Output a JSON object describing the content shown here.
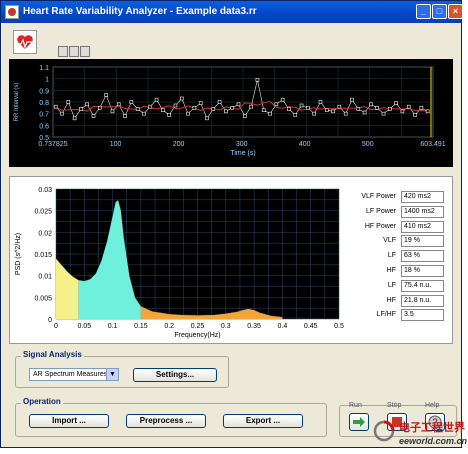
{
  "window": {
    "title": "Heart Rate Variability Analyzer - Example data3.rr"
  },
  "title_buttons": {
    "minimize": "_",
    "maximize": "□",
    "close": "×"
  },
  "top_chart": {
    "x_label": "Time (s)",
    "y_label": "RR Interval (s)",
    "x_ticks": [
      "0.737825",
      "100",
      "200",
      "300",
      "400",
      "500",
      "603.491"
    ],
    "y_ticks": [
      "1.1",
      "1",
      "0.9",
      "0.8",
      "0.7",
      "0.6",
      "0.5"
    ]
  },
  "chart_data": [
    {
      "type": "scatter",
      "y_label": "RR Interval (s)",
      "xlabel": "Time (s)",
      "xlim": [
        0.737825,
        603.491
      ],
      "ylim": [
        0.5,
        1.1
      ],
      "series": [
        {
          "x": [
            5,
            15,
            25,
            35,
            45,
            55,
            65,
            75,
            85,
            95,
            105,
            115,
            125,
            135,
            145,
            155,
            165,
            175,
            185,
            195,
            205,
            215,
            225,
            235,
            245,
            255,
            265,
            275,
            285,
            295,
            305,
            315,
            325,
            335,
            345,
            355,
            365,
            375,
            385,
            395,
            405,
            415,
            425,
            435,
            445,
            455,
            465,
            475,
            485,
            495,
            505,
            515,
            525,
            535,
            545,
            555,
            565,
            575,
            585,
            595
          ],
          "y": [
            0.76,
            0.7,
            0.8,
            0.66,
            0.74,
            0.78,
            0.68,
            0.75,
            0.86,
            0.72,
            0.78,
            0.68,
            0.8,
            0.74,
            0.7,
            0.76,
            0.82,
            0.73,
            0.69,
            0.77,
            0.83,
            0.7,
            0.75,
            0.79,
            0.66,
            0.74,
            0.8,
            0.72,
            0.75,
            0.78,
            0.68,
            0.76,
            0.99,
            0.73,
            0.7,
            0.78,
            0.82,
            0.74,
            0.69,
            0.77,
            0.75,
            0.7,
            0.8,
            0.73,
            0.72,
            0.76,
            0.7,
            0.82,
            0.74,
            0.71,
            0.78,
            0.75,
            0.7,
            0.74,
            0.79,
            0.72,
            0.76,
            0.69,
            0.75,
            0.72
          ]
        }
      ]
    },
    {
      "type": "area",
      "ylabel": "PSD (s^2/Hz)",
      "xlabel": "Frequency(Hz)",
      "xlim": [
        0,
        0.5
      ],
      "ylim": [
        0,
        0.03
      ],
      "x_ticks": [
        "0",
        "0.05",
        "0.1",
        "0.15",
        "0.2",
        "0.25",
        "0.3",
        "0.35",
        "0.4",
        "0.45",
        "0.5"
      ],
      "y_ticks": [
        "0.03",
        "0.025",
        "0.02",
        "0.015",
        "0.01",
        "0.005",
        "0"
      ],
      "band_colors": {
        "vlf": "#f4f08a",
        "lf": "#6ff0dc",
        "hf": "#f3a53a"
      },
      "bands": [
        0.04,
        0.15,
        0.4
      ],
      "x": [
        0,
        0.01,
        0.02,
        0.03,
        0.04,
        0.05,
        0.06,
        0.07,
        0.08,
        0.09,
        0.1,
        0.105,
        0.11,
        0.115,
        0.12,
        0.13,
        0.14,
        0.15,
        0.17,
        0.2,
        0.22,
        0.25,
        0.28,
        0.3,
        0.32,
        0.33,
        0.34,
        0.35,
        0.36,
        0.38,
        0.4,
        0.42,
        0.45,
        0.48,
        0.5
      ],
      "y": [
        0.014,
        0.0125,
        0.011,
        0.0098,
        0.009,
        0.0088,
        0.0092,
        0.0105,
        0.0135,
        0.018,
        0.024,
        0.027,
        0.0275,
        0.025,
        0.019,
        0.01,
        0.005,
        0.003,
        0.0018,
        0.0012,
        0.001,
        0.0009,
        0.001,
        0.0013,
        0.0017,
        0.0021,
        0.0024,
        0.0021,
        0.0015,
        0.0008,
        0.0005,
        0.0003,
        0.0002,
        0.0001,
        0.0001
      ]
    }
  ],
  "metrics": [
    {
      "label": "VLF Power",
      "value": "420 ms2"
    },
    {
      "label": "LF Power",
      "value": "1400 ms2"
    },
    {
      "label": "HF Power",
      "value": "410 ms2"
    },
    {
      "label": "VLF",
      "value": "19 %"
    },
    {
      "label": "LF",
      "value": "63 %"
    },
    {
      "label": "HF",
      "value": "18 %"
    },
    {
      "label": "LF",
      "value": "75.4 n.u."
    },
    {
      "label": "HF",
      "value": "21.8 n.u."
    },
    {
      "label": "LF/HF",
      "value": "3.5"
    }
  ],
  "signal_analysis": {
    "title": "Signal Analysis",
    "selected": "AR Spectrum Measures",
    "settings_label": "Settings..."
  },
  "operation": {
    "title": "Operation",
    "import_label": "Import ...",
    "preprocess_label": "Preprocess ...",
    "export_label": "Export ..."
  },
  "controls": {
    "run_label": "Run",
    "stop_label": "Stop",
    "help_label": "Help"
  },
  "watermark": {
    "cn_text": "电子工程世界",
    "domain": "eeworld.com.cn"
  }
}
